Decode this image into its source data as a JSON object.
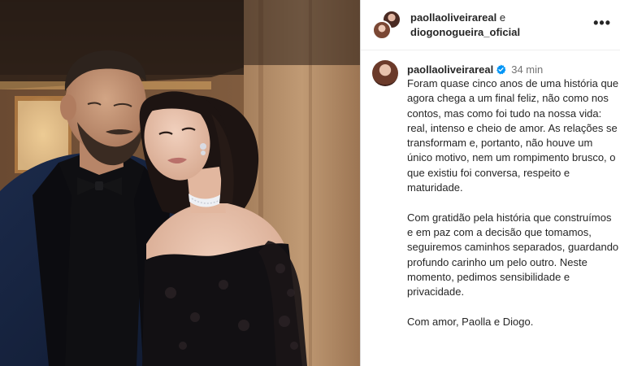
{
  "header": {
    "user1": "paollaoliveirareal",
    "conjunction": "e",
    "user2": "diogonogueira_oficial",
    "more_icon": "more-horizontal-icon"
  },
  "caption": {
    "username": "paollaoliveirareal",
    "verified_icon": "verified-badge-icon",
    "time": "34 min",
    "paragraphs": [
      "Foram quase cinco anos de uma história que agora chega a um final feliz, não como nos contos, mas como foi tudo na nossa vida: real, intenso e cheio de amor. As relações se transformam e, portanto, não houve um único motivo, nem um rompimento brusco, o que existiu foi conversa, respeito e maturidade.",
      "Com gratidão pela história que construímos e em paz com a decisão que tomamos, seguiremos caminhos separados, guardando profundo carinho um pelo outro. Neste momento, pedimos sensibilidade e privacidade.",
      "Com amor, Paolla e Diogo."
    ]
  },
  "colors": {
    "verified": "#0095f6",
    "muted": "#737373",
    "text": "#262626"
  }
}
